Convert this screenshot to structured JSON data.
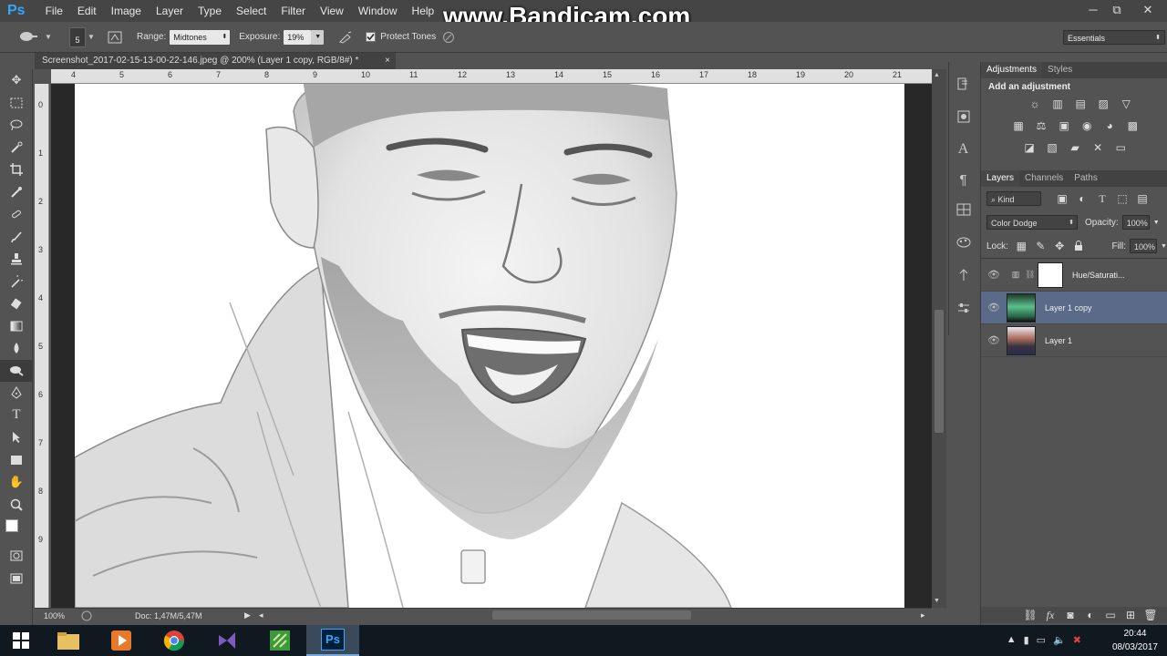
{
  "app": {
    "logo": "Ps"
  },
  "menu": [
    "File",
    "Edit",
    "Image",
    "Layer",
    "Type",
    "Select",
    "Filter",
    "View",
    "Window",
    "Help"
  ],
  "watermark": "www.Bandicam.com",
  "window_controls": {
    "minimize": "─",
    "restore": "⧉",
    "close": "✕"
  },
  "options": {
    "brush_size": "5",
    "range_label": "Range:",
    "range_value": "Midtones",
    "exposure_label": "Exposure:",
    "exposure_value": "19%",
    "protect_tones_label": "Protect Tones",
    "protect_tones_checked": true,
    "workspace": "Essentials"
  },
  "document": {
    "tab_title": "Screenshot_2017-02-15-13-00-22-146.jpeg @ 200% (Layer 1 copy, RGB/8#) *",
    "close_glyph": "×"
  },
  "ruler": {
    "h_ticks": [
      "4",
      "5",
      "6",
      "7",
      "8",
      "9",
      "10",
      "11",
      "12",
      "13",
      "14",
      "15",
      "16",
      "17",
      "18",
      "19",
      "20",
      "21"
    ],
    "v_ticks": [
      "0",
      "1",
      "2",
      "3",
      "4",
      "5",
      "6",
      "7",
      "8",
      "9"
    ]
  },
  "status": {
    "zoom": "100%",
    "doc": "Doc: 1,47M/5,47M"
  },
  "panels": {
    "adjustments_tab": "Adjustments",
    "styles_tab": "Styles",
    "add_adjustment": "Add an adjustment",
    "adj_row1": [
      "☼",
      "▥",
      "▤",
      "▨",
      "▽"
    ],
    "adj_row2": [
      "▦",
      "⚖",
      "▣",
      "◉",
      "◕",
      "▩"
    ],
    "adj_row3": [
      "◪",
      "▧",
      "▰",
      "✕",
      "▭"
    ],
    "layers_tab": "Layers",
    "channels_tab": "Channels",
    "paths_tab": "Paths",
    "filter_kind": "Kind",
    "blend_mode": "Color Dodge",
    "opacity_label": "Opacity:",
    "opacity_value": "100%",
    "lock_label": "Lock:",
    "fill_label": "Fill:",
    "fill_value": "100%",
    "layers": [
      {
        "name": "Hue/Saturati...",
        "type": "adjustment",
        "selected": false
      },
      {
        "name": "Layer 1 copy",
        "type": "image-inverted",
        "selected": true
      },
      {
        "name": "Layer 1",
        "type": "image",
        "selected": false
      }
    ]
  },
  "taskbar": {
    "time": "20:44",
    "date": "08/03/2017",
    "ps_label": "Ps"
  },
  "colors": {
    "accent": "#31a8ff",
    "selected_layer": "#5a6a88",
    "panel_bg": "#535353"
  }
}
